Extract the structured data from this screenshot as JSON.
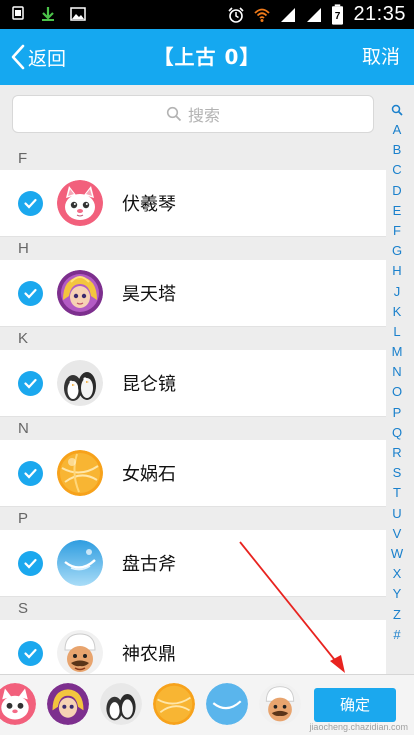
{
  "status_bar": {
    "time": "21:35",
    "battery": "7"
  },
  "header": {
    "back_label": "返回",
    "title": "【上古 0】",
    "cancel_label": "取消"
  },
  "search": {
    "placeholder": "搜索"
  },
  "sections": [
    {
      "letter": "F",
      "contact": {
        "name": "伏羲琴",
        "avatar": "cat-avatar",
        "checked": true
      }
    },
    {
      "letter": "H",
      "contact": {
        "name": "昊天塔",
        "avatar": "blonde-girl-avatar",
        "checked": true
      }
    },
    {
      "letter": "K",
      "contact": {
        "name": "昆仑镜",
        "avatar": "penguin-avatar",
        "checked": true
      }
    },
    {
      "letter": "N",
      "contact": {
        "name": "女娲石",
        "avatar": "orange-ball-avatar",
        "checked": true
      }
    },
    {
      "letter": "P",
      "contact": {
        "name": "盘古斧",
        "avatar": "blue-sky-avatar",
        "checked": true
      }
    },
    {
      "letter": "S",
      "contact": {
        "name": "神农鼎",
        "avatar": "chef-avatar",
        "checked": true
      }
    }
  ],
  "index_letters": [
    "A",
    "B",
    "C",
    "D",
    "E",
    "F",
    "G",
    "H",
    "J",
    "K",
    "L",
    "M",
    "N",
    "O",
    "P",
    "Q",
    "R",
    "S",
    "T",
    "U",
    "V",
    "W",
    "X",
    "Y",
    "Z",
    "#"
  ],
  "bottom_bar": {
    "confirm_label": "确定",
    "watermark": "jiaocheng.chazidian.com"
  },
  "colors": {
    "accent": "#15a8f0",
    "check": "#1ba8ee",
    "index": "#1a80cc",
    "annotation": "#e8231f"
  }
}
